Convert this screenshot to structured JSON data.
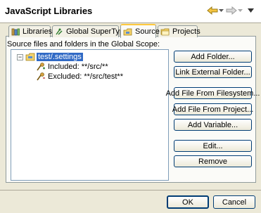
{
  "header": {
    "title": "JavaScript Libraries"
  },
  "tabs": [
    {
      "label": "Libraries",
      "icon": "libraries-icon",
      "active": false
    },
    {
      "label": "Global SuperType",
      "icon": "global-supertype-icon",
      "active": false
    },
    {
      "label": "Source",
      "icon": "source-folder-icon",
      "active": true
    },
    {
      "label": "Projects",
      "icon": "projects-icon",
      "active": false
    }
  ],
  "source": {
    "description": "Source files and folders in the Global Scope:",
    "tree": {
      "root": "test/.settings",
      "included": "Included: **/src/**",
      "excluded": "Excluded: **/src/test**"
    },
    "buttons": {
      "add_folder": "Add Folder...",
      "link_external": "Link External Folder...",
      "add_file_fs": "Add File From Filesystem...",
      "add_file_project": "Add File From Project...",
      "add_variable": "Add Variable...",
      "edit": "Edit...",
      "remove": "Remove"
    }
  },
  "dialog": {
    "ok": "OK",
    "cancel": "Cancel"
  },
  "colors": {
    "selection": "#316ac5",
    "active_tab_accent": "#ffc83c",
    "dialog_bg": "#ece9d8"
  }
}
